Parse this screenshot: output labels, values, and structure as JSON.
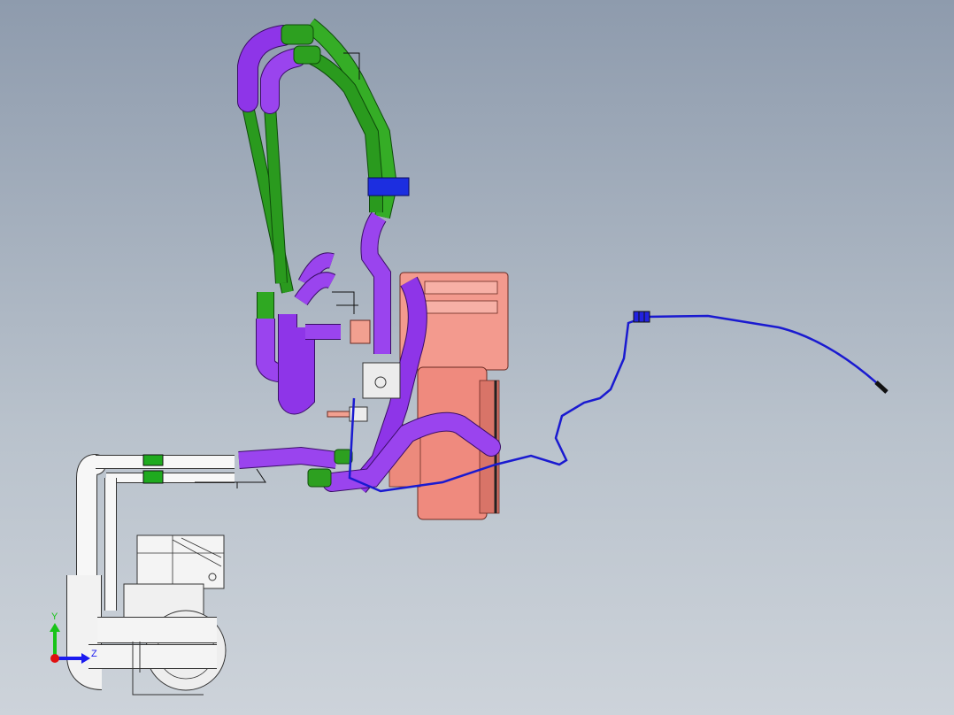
{
  "viewport": {
    "background_top": "#8e9bad",
    "background_bottom": "#cdd3da"
  },
  "model": {
    "parts": [
      {
        "name": "green-hose-assembly",
        "color": "#1f8a14"
      },
      {
        "name": "purple-hose-assembly",
        "color": "#8a2be2"
      },
      {
        "name": "salmon-heater-core",
        "color": "#f08a80"
      },
      {
        "name": "blue-wire-harness",
        "color": "#1a1ad0"
      },
      {
        "name": "white-pipe-assembly",
        "color": "#f2f2f2"
      },
      {
        "name": "blue-clamp",
        "color": "#1c2ee0"
      }
    ]
  },
  "triad": {
    "y_label": "Y",
    "z_label": "Z",
    "y_color": "#18c418",
    "z_color": "#1a1af0",
    "origin_color": "#e01010"
  }
}
